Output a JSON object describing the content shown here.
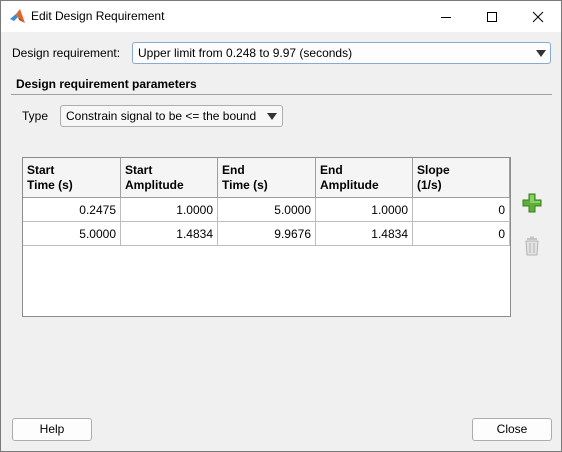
{
  "window": {
    "title": "Edit Design Requirement",
    "icons": [
      "matlab-icon",
      "minimize-icon",
      "maximize-icon",
      "close-icon"
    ]
  },
  "design_requirement": {
    "label": "Design requirement:",
    "value": "Upper limit from 0.248 to 9.97 (seconds)"
  },
  "parameters": {
    "section_title": "Design requirement parameters",
    "type_label": "Type",
    "type_value": "Constrain signal to be <= the bound"
  },
  "table": {
    "columns": [
      [
        "Start",
        "Time (s)"
      ],
      [
        "Start",
        "Amplitude"
      ],
      [
        "End",
        "Time (s)"
      ],
      [
        "End",
        "Amplitude"
      ],
      [
        "Slope",
        "(1/s)"
      ]
    ],
    "rows": [
      [
        "0.2475",
        "1.0000",
        "5.0000",
        "1.0000",
        "0"
      ],
      [
        "5.0000",
        "1.4834",
        "9.9676",
        "1.4834",
        "0"
      ]
    ]
  },
  "side_buttons": {
    "add": "add-row-icon",
    "delete": "delete-row-icon"
  },
  "footer": {
    "help_label": "Help",
    "close_label": "Close"
  },
  "colors": {
    "accent_border": "#8aa8d0",
    "add_green": "#5bb135"
  }
}
